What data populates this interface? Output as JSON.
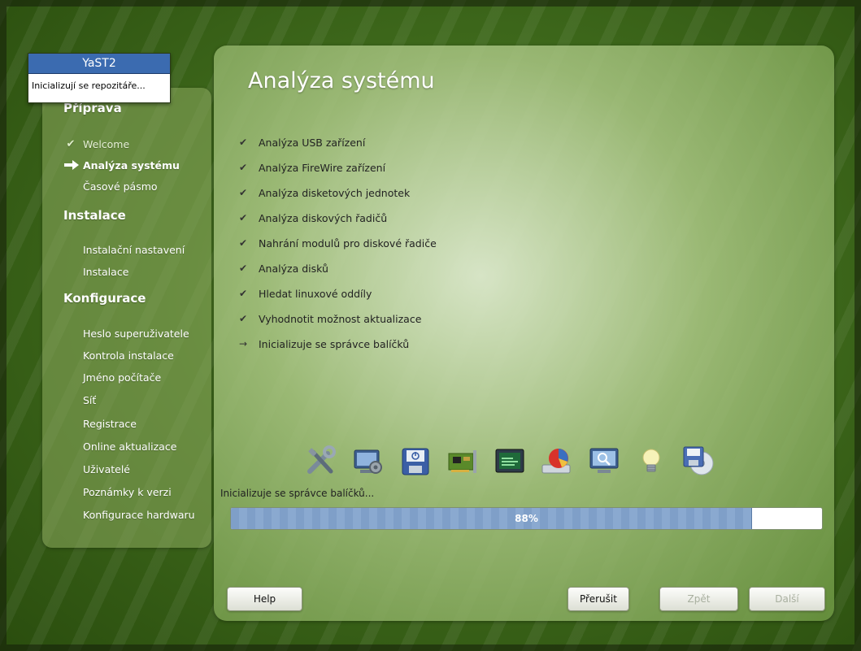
{
  "popup": {
    "title": "YaST2",
    "message": "Inicializují se repozitáře..."
  },
  "sidebar": {
    "sections": [
      {
        "label": "Příprava"
      },
      {
        "label": "Instalace"
      },
      {
        "label": "Konfigurace"
      }
    ],
    "items": [
      {
        "label": "Welcome",
        "state": "done"
      },
      {
        "label": "Analýza systému",
        "state": "current"
      },
      {
        "label": "Časové pásmo",
        "state": "pending"
      },
      {
        "label": "Instalační nastavení",
        "state": "pending"
      },
      {
        "label": "Instalace",
        "state": "pending"
      },
      {
        "label": "Heslo superuživatele",
        "state": "pending"
      },
      {
        "label": "Kontrola instalace",
        "state": "pending"
      },
      {
        "label": "Jméno počítače",
        "state": "pending"
      },
      {
        "label": "Síť",
        "state": "pending"
      },
      {
        "label": "Registrace",
        "state": "pending"
      },
      {
        "label": "Online aktualizace",
        "state": "pending"
      },
      {
        "label": "Uživatelé",
        "state": "pending"
      },
      {
        "label": "Poznámky k verzi",
        "state": "pending"
      },
      {
        "label": "Konfigurace hardwaru",
        "state": "pending"
      }
    ]
  },
  "main": {
    "title": "Analýza systému",
    "steps": [
      {
        "label": "Analýza USB zařízení",
        "mark": "✔"
      },
      {
        "label": "Analýza FireWire zařízení",
        "mark": "✔"
      },
      {
        "label": "Analýza disketových jednotek",
        "mark": "✔"
      },
      {
        "label": "Analýza diskových řadičů",
        "mark": "✔"
      },
      {
        "label": "Nahrání modulů pro diskové řadiče",
        "mark": "✔"
      },
      {
        "label": "Analýza disků",
        "mark": "✔"
      },
      {
        "label": "Hledat linuxové oddíly",
        "mark": "✔"
      },
      {
        "label": "Vyhodnotit možnost aktualizace",
        "mark": "✔"
      },
      {
        "label": "Inicializuje se správce balíčků",
        "mark": "→"
      }
    ],
    "icons": [
      "tools-icon",
      "system-settings-icon",
      "floppy-power-icon",
      "pci-card-icon",
      "monitor-chip-icon",
      "disk-partition-icon",
      "search-monitor-icon",
      "lightbulb-icon",
      "floppy-cd-icon"
    ],
    "progress": {
      "label": "Inicializuje se správce balíčků...",
      "percent_text": "88%",
      "value": 0.88
    }
  },
  "buttons": {
    "help": "Help",
    "abort": "Přerušit",
    "back": "Zpět",
    "next": "Další"
  },
  "colors": {
    "accent": "#3b6bb0",
    "progress": "#7f9fc8"
  }
}
